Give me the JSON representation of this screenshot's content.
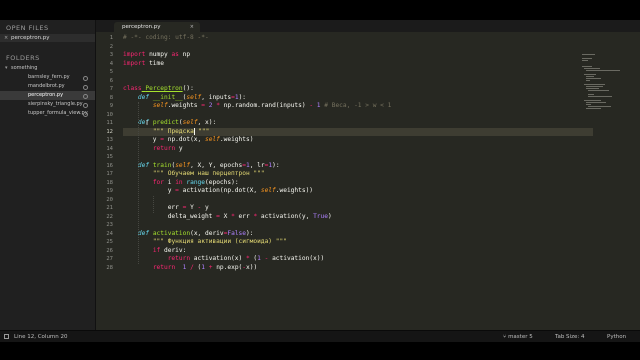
{
  "sidebar": {
    "open_files_header": "OPEN FILES",
    "open_files": [
      {
        "name": "perceptron.py"
      }
    ],
    "folders_header": "FOLDERS",
    "folder_root": "something",
    "files": [
      {
        "name": "barnsley_fern.py",
        "selected": false
      },
      {
        "name": "mandelbrot.py",
        "selected": false
      },
      {
        "name": "perceptron.py",
        "selected": true
      },
      {
        "name": "sierpinsky_triangle.py",
        "selected": false
      },
      {
        "name": "tupper_formula_view.py",
        "selected": false
      }
    ]
  },
  "tabs": [
    {
      "label": "perceptron.py",
      "active": true
    }
  ],
  "editor": {
    "line_numbers": [
      "1",
      "2",
      "3",
      "4",
      "5",
      "6",
      "7",
      "8",
      "9",
      "10",
      "11",
      "12",
      "13",
      "14",
      "15",
      "16",
      "17",
      "18",
      "19",
      "20",
      "21",
      "22",
      "23",
      "24",
      "25",
      "26",
      "27",
      "28"
    ],
    "current_line": "12",
    "lines": [
      "# -*- coding: utf-8 -*-",
      "",
      "import numpy as np",
      "import time",
      "",
      "",
      "class Perceptron():",
      "    def __init__(self, inputs=1):",
      "        self.weights = 2 * np.random.rand(inputs) - 1 # Веса, -1 > w < 1",
      "",
      "    def predict(self, x):",
      "        \"\"\" Предска \"\"\"",
      "        y = np.dot(x, self.weights)",
      "        return y",
      "",
      "    def train(self, X, Y, epochs=1, lr=1):",
      "        \"\"\" Обучаем наш перцептрон \"\"\"",
      "        for i in range(epochs):",
      "            y = activation(np.dot(X, self.weights))",
      "",
      "            err = Y - y",
      "            delta_weight = X * err * activation(y, True)",
      "",
      "    def activation(x, deriv=False):",
      "        \"\"\" Функция активации (сигмоида) \"\"\"",
      "        if deriv:",
      "            return activation(x) * (1 - activation(x))",
      "        return  1 / (1 + np.exp(-x))"
    ]
  },
  "status": {
    "position": "Line 12, Column 20",
    "branch": "master",
    "branch_count": "5",
    "tab_size": "Tab Size: 4",
    "syntax": "Python"
  },
  "colors": {
    "background": "#272822",
    "keyword": "#f92672",
    "function": "#a6e22e",
    "string": "#e6db74",
    "number": "#ae81ff",
    "comment": "#75715e",
    "storage": "#66d9ef",
    "parameter": "#fd971f"
  }
}
